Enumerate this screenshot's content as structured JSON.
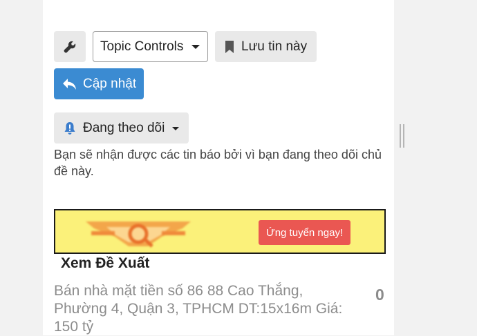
{
  "toolbar": {
    "wrench_icon": "wrench-icon",
    "topic_controls_label": "Topic Controls",
    "bookmark_label": "Lưu tin này",
    "reply_label": "Cập nhật"
  },
  "notifications": {
    "level_label": "Đang theo dõi",
    "description": "Bạn sẽ nhận được các tin báo bởi vì bạn đang theo dõi chủ đề này."
  },
  "advert": {
    "cta_label": "Ứng tuyển ngay!",
    "background": "#fbf17a",
    "cta_color": "#ea5752"
  },
  "suggested": {
    "title": "Xem Đề Xuất",
    "topics": [
      {
        "title": "Bán nhà mặt tiền số 86 88 Cao Thắng, Phường 4, Quận 3, TPHCM DT:15x16m Giá: 150 tỷ",
        "replies": "0"
      }
    ]
  },
  "colors": {
    "primary": "#3b8bd2",
    "button_bg": "#e9e9e9",
    "muted_text": "#8c8c8c"
  }
}
